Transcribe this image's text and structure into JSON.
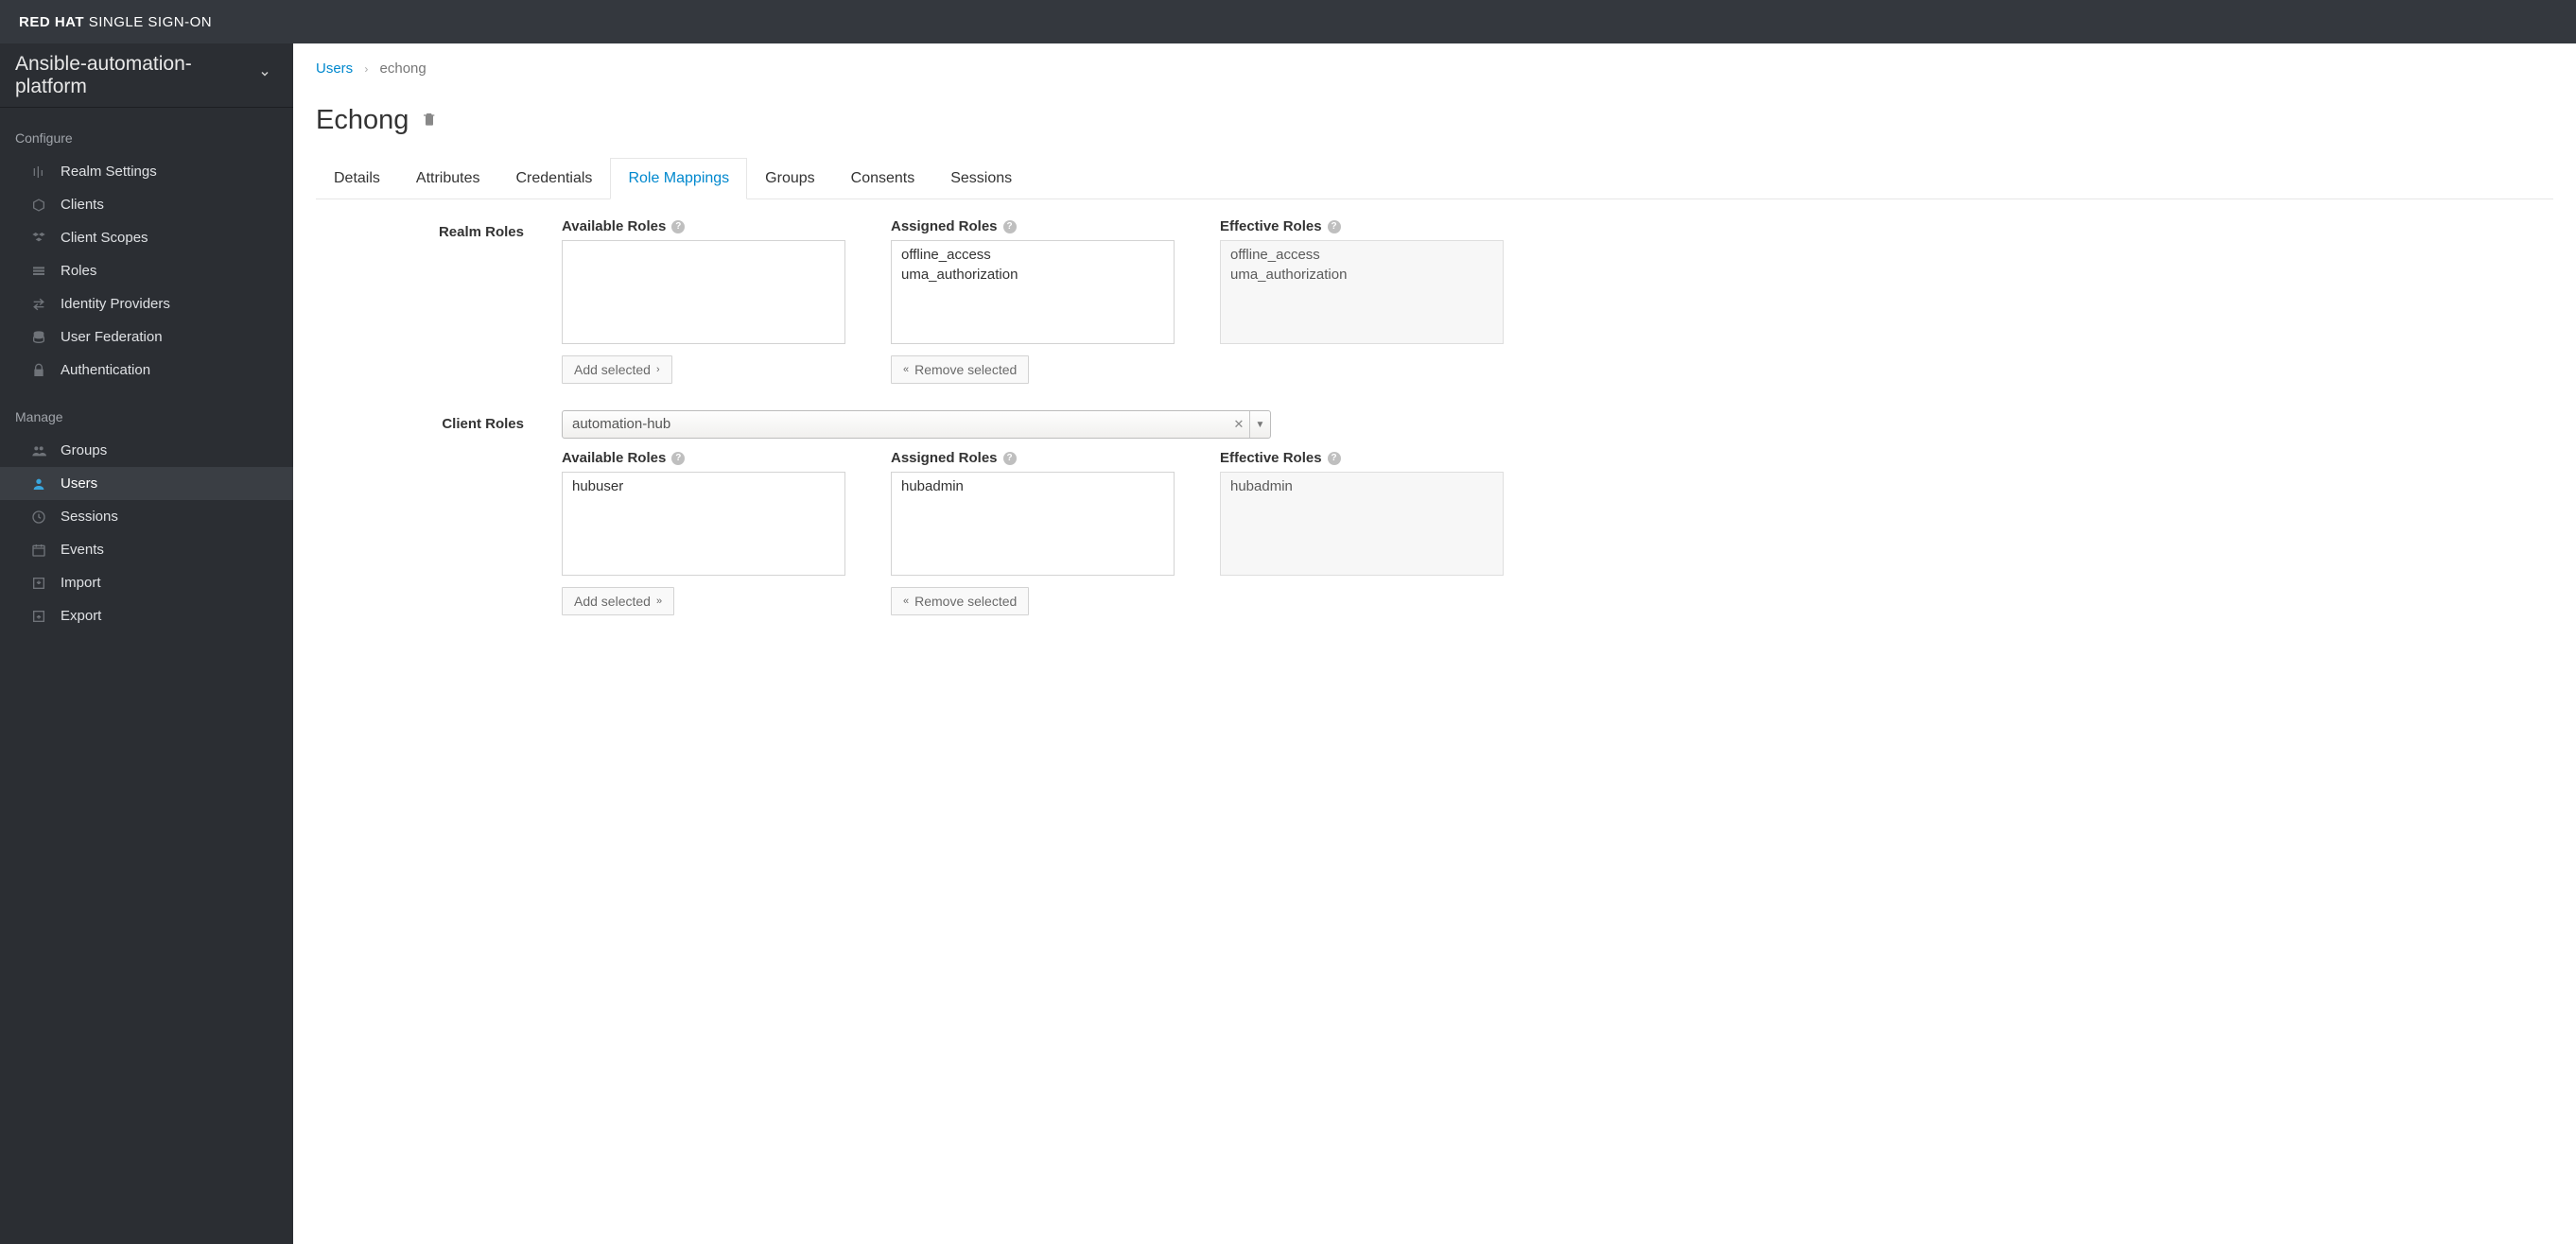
{
  "brand": {
    "redhat": "RED HAT",
    "product": "SINGLE SIGN-ON"
  },
  "realm_selector": {
    "name": "Ansible-automation-platform"
  },
  "sidebar": {
    "configure_label": "Configure",
    "manage_label": "Manage",
    "configure_items": [
      {
        "label": "Realm Settings",
        "name": "realm-settings",
        "icon": "sliders"
      },
      {
        "label": "Clients",
        "name": "clients",
        "icon": "cube"
      },
      {
        "label": "Client Scopes",
        "name": "client-scopes",
        "icon": "cubes"
      },
      {
        "label": "Roles",
        "name": "roles",
        "icon": "list"
      },
      {
        "label": "Identity Providers",
        "name": "identity-providers",
        "icon": "transfer"
      },
      {
        "label": "User Federation",
        "name": "user-federation",
        "icon": "database"
      },
      {
        "label": "Authentication",
        "name": "authentication",
        "icon": "lock"
      }
    ],
    "manage_items": [
      {
        "label": "Groups",
        "name": "groups",
        "icon": "users"
      },
      {
        "label": "Users",
        "name": "users",
        "icon": "user",
        "active": true
      },
      {
        "label": "Sessions",
        "name": "sessions",
        "icon": "clock"
      },
      {
        "label": "Events",
        "name": "events",
        "icon": "calendar"
      },
      {
        "label": "Import",
        "name": "import",
        "icon": "import"
      },
      {
        "label": "Export",
        "name": "export",
        "icon": "export"
      }
    ]
  },
  "breadcrumb": {
    "parent": "Users",
    "current": "echong"
  },
  "page_title": "Echong",
  "tabs": [
    {
      "label": "Details",
      "name": "details"
    },
    {
      "label": "Attributes",
      "name": "attributes"
    },
    {
      "label": "Credentials",
      "name": "credentials"
    },
    {
      "label": "Role Mappings",
      "name": "role-mappings",
      "active": true
    },
    {
      "label": "Groups",
      "name": "groups"
    },
    {
      "label": "Consents",
      "name": "consents"
    },
    {
      "label": "Sessions",
      "name": "sessions"
    }
  ],
  "realm_roles": {
    "label": "Realm Roles",
    "available": {
      "label": "Available Roles",
      "items": []
    },
    "assigned": {
      "label": "Assigned Roles",
      "items": [
        "offline_access",
        "uma_authorization"
      ]
    },
    "effective": {
      "label": "Effective Roles",
      "items": [
        "offline_access",
        "uma_authorization"
      ]
    },
    "add_btn": "Add selected",
    "remove_btn": "Remove selected"
  },
  "client_roles": {
    "label": "Client Roles",
    "selected_client": "automation-hub",
    "available": {
      "label": "Available Roles",
      "items": [
        "hubuser"
      ]
    },
    "assigned": {
      "label": "Assigned Roles",
      "items": [
        "hubadmin"
      ]
    },
    "effective": {
      "label": "Effective Roles",
      "items": [
        "hubadmin"
      ]
    },
    "add_btn": "Add selected",
    "remove_btn": "Remove selected"
  }
}
